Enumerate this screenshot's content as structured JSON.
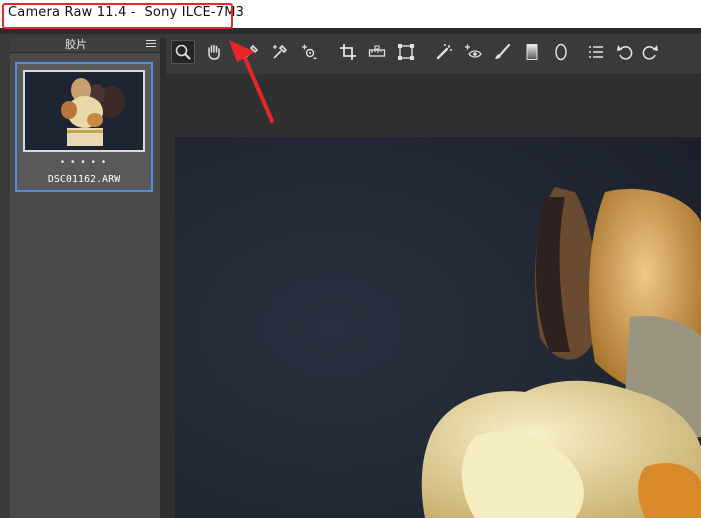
{
  "window": {
    "title": "Camera Raw 11.4 -  Sony ILCE-7M3"
  },
  "filmstrip": {
    "title": "胶片",
    "items": [
      {
        "filename": "DSC01162.ARW",
        "rating": "• • • • •"
      }
    ]
  },
  "toolbar": {
    "tools": [
      "zoom-icon",
      "hand-icon",
      "white-balance-icon",
      "color-sampler-icon",
      "targeted-adjustment-icon",
      "crop-icon",
      "straighten-icon",
      "transform-icon",
      "spot-removal-icon",
      "red-eye-icon",
      "adjustment-brush-icon",
      "graduated-filter-icon",
      "radial-filter-icon",
      "preferences-icon",
      "rotate-left-icon",
      "rotate-right-icon"
    ],
    "active": "zoom-icon"
  },
  "colors": {
    "highlight": "#e8262a",
    "selection": "#4f8ee6"
  }
}
